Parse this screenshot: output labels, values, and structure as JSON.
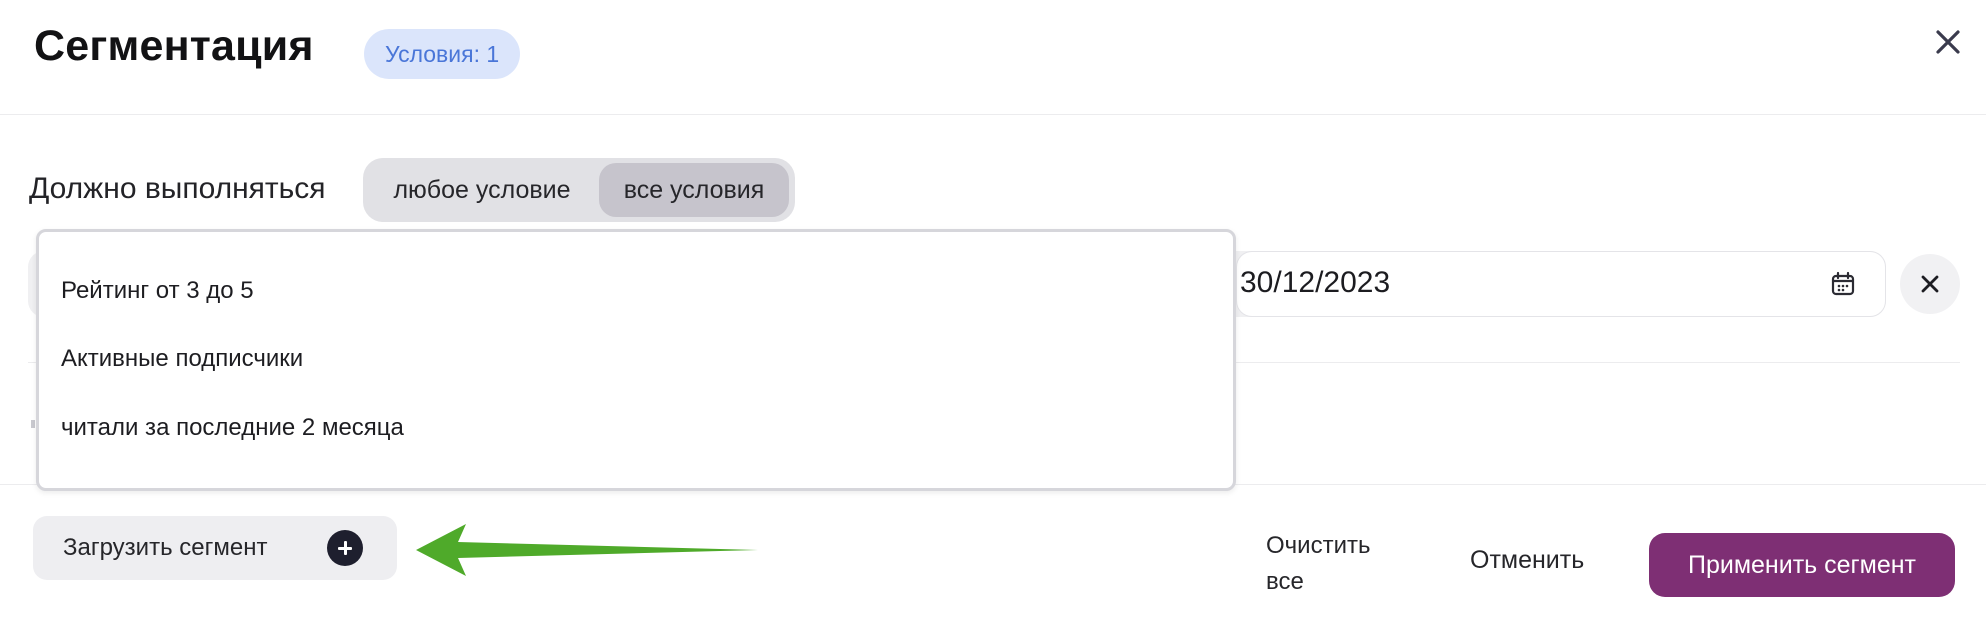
{
  "header": {
    "title": "Сегментация",
    "conditions_badge": "Условия: 1"
  },
  "match": {
    "label": "Должно выполняться",
    "options": [
      "любое условие",
      "все условия"
    ],
    "selected": "все условия"
  },
  "condition_row": {
    "date_value": "30/12/2023"
  },
  "dropdown": {
    "items": [
      "Рейтинг от 3 до 5",
      "Активные подписчики",
      "читали за последние 2 месяца"
    ]
  },
  "footer": {
    "load_segment_label": "Загрузить сегмент",
    "clear_all_label": "Очистить все",
    "cancel_label": "Отменить",
    "apply_label": "Применить сегмент"
  },
  "colors": {
    "badge_bg": "#dbe5fb",
    "badge_text": "#4a76d8",
    "apply_button": "#7e2f74",
    "annotation_arrow": "#4faa2a"
  },
  "icons": {
    "close": "close-icon",
    "calendar": "calendar-icon",
    "plus": "plus-circle-icon",
    "arrow": "annotation-arrow"
  }
}
